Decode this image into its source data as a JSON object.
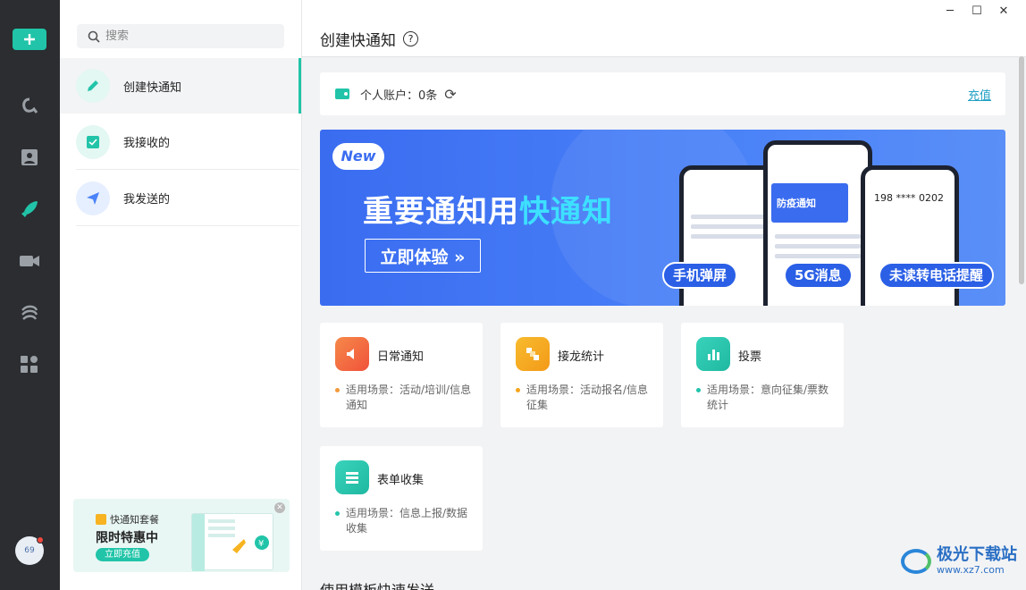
{
  "rail": {
    "items": [
      {
        "name": "brand-icon"
      },
      {
        "name": "contacts-icon"
      },
      {
        "name": "rocket-icon"
      },
      {
        "name": "video-icon"
      },
      {
        "name": "cloud-icon"
      },
      {
        "name": "apps-icon"
      }
    ],
    "avatar_text": "69"
  },
  "search": {
    "placeholder": "搜索"
  },
  "nav": {
    "items": [
      {
        "label": "创建快通知",
        "active": true
      },
      {
        "label": "我接收的"
      },
      {
        "label": "我发送的"
      }
    ]
  },
  "promo": {
    "tag": "快通知套餐",
    "title": "限时特惠中",
    "button": "立即充值"
  },
  "header": {
    "title": "创建快通知",
    "help": "?",
    "win_minimize": "─",
    "win_maximize": "☐",
    "win_close": "✕"
  },
  "account": {
    "label": "个人账户：0条",
    "recharge": "充值"
  },
  "banner": {
    "badge": "New",
    "headline_prefix": "重要通知用",
    "headline_highlight": "快通知",
    "cta": "立即体验 »",
    "pill_popup": "手机弹屏",
    "pill_5g": "5G消息",
    "pill_call": "未读转电话提醒",
    "card_5g": "防疫通知",
    "phone_number": "198 **** 0202"
  },
  "cards": [
    {
      "title": "日常通知",
      "desc": "适用场景：活动/培训/信息通知",
      "color": "#f3673b",
      "dot": "#f39a3b"
    },
    {
      "title": "接龙统计",
      "desc": "适用场景：活动报名/信息征集",
      "color": "#f6a51c",
      "dot": "#f6a51c"
    },
    {
      "title": "投票",
      "desc": "适用场景：意向征集/票数统计",
      "color": "#22c4ab",
      "dot": "#22c4ab"
    },
    {
      "title": "表单收集",
      "desc": "适用场景：信息上报/数据收集",
      "color": "#22c4ab",
      "dot": "#22c4ab"
    }
  ],
  "section_title": "使用模板快速发送",
  "watermark": {
    "title": "极光下载站",
    "url": "www.xz7.com"
  }
}
